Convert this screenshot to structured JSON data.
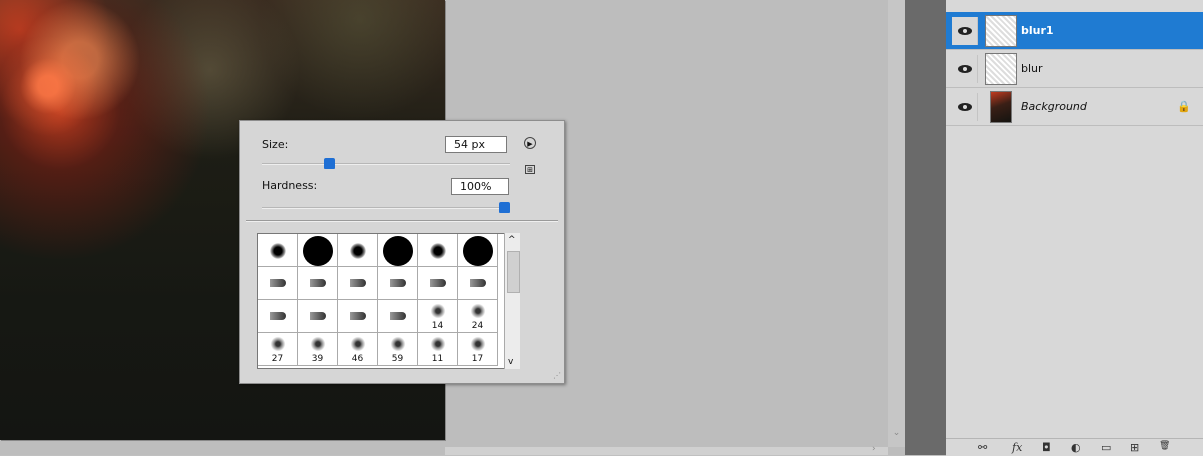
{
  "document": {
    "scroll_right_arrow": "›",
    "scroll_down_arrow": "⌄"
  },
  "brush_picker": {
    "size_label": "Size:",
    "size_value": "54 px",
    "size_slider_fraction": 0.27,
    "hardness_label": "Hardness:",
    "hardness_value": "100%",
    "hardness_slider_fraction": 1.0,
    "menu_icon": "flyout-menu-icon",
    "new_preset_icon": "new-preset-icon",
    "scroll_up": "^",
    "scroll_down": "v",
    "presets": [
      {
        "kind": "soft",
        "label": ""
      },
      {
        "kind": "hard",
        "label": ""
      },
      {
        "kind": "soft",
        "label": ""
      },
      {
        "kind": "hard",
        "label": ""
      },
      {
        "kind": "soft",
        "label": ""
      },
      {
        "kind": "hard",
        "label": ""
      },
      {
        "kind": "tip",
        "label": ""
      },
      {
        "kind": "tip",
        "label": ""
      },
      {
        "kind": "tip",
        "label": ""
      },
      {
        "kind": "tip",
        "label": ""
      },
      {
        "kind": "tip",
        "label": ""
      },
      {
        "kind": "tip",
        "label": ""
      },
      {
        "kind": "tip",
        "label": ""
      },
      {
        "kind": "tip",
        "label": ""
      },
      {
        "kind": "tip",
        "label": ""
      },
      {
        "kind": "tip",
        "label": ""
      },
      {
        "kind": "scatter",
        "label": "14"
      },
      {
        "kind": "scatter",
        "label": "24"
      },
      {
        "kind": "scatter",
        "label": "27"
      },
      {
        "kind": "scatter",
        "label": "39"
      },
      {
        "kind": "scatter",
        "label": "46"
      },
      {
        "kind": "scatter",
        "label": "59"
      },
      {
        "kind": "scatter",
        "label": "11"
      },
      {
        "kind": "scatter",
        "label": "17"
      }
    ]
  },
  "layers": {
    "items": [
      {
        "name": "blur1",
        "selected": true,
        "visible": true,
        "thumbnail": "pattern",
        "italic": false,
        "locked": false
      },
      {
        "name": "blur",
        "selected": false,
        "visible": true,
        "thumbnail": "pattern",
        "italic": false,
        "locked": false
      },
      {
        "name": "Background",
        "selected": false,
        "visible": true,
        "thumbnail": "bg",
        "italic": true,
        "locked": true
      }
    ],
    "footer_icons": [
      "link-icon",
      "fx-icon",
      "mask-icon",
      "adjustment-icon",
      "group-icon",
      "new-layer-icon",
      "trash-icon"
    ],
    "footer_glyphs": [
      "⚯",
      "fx",
      "◘",
      "◐",
      "▭",
      "⊞",
      "🗑"
    ],
    "lock_glyph": "🔒",
    "eye_icon": "eye-icon"
  },
  "colors": {
    "accent": "#1f7bd2",
    "slider_thumb": "#1f6fd4"
  }
}
